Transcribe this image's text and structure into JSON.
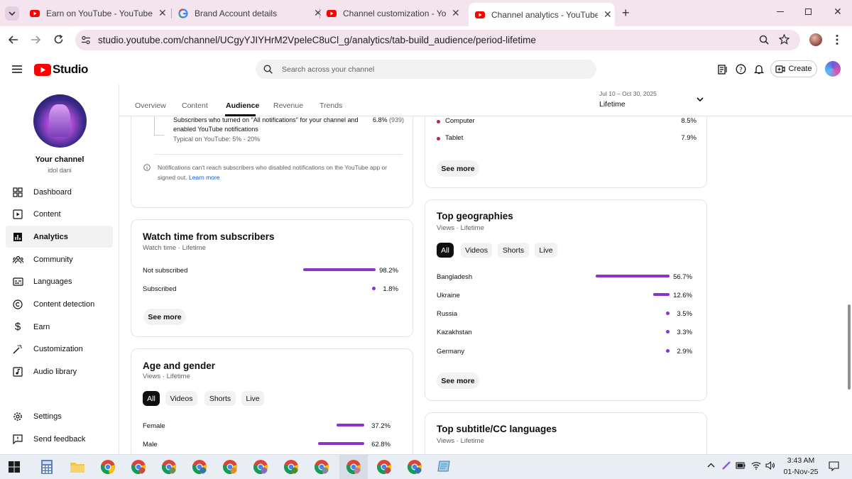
{
  "browser": {
    "tabs": [
      {
        "title": "Earn on YouTube - YouTube Stu",
        "active": false
      },
      {
        "title": "Brand Account details",
        "active": false
      },
      {
        "title": "Channel customization - YouTu",
        "active": false
      },
      {
        "title": "Channel analytics - YouTube Stu",
        "active": true
      }
    ],
    "url": "studio.youtube.com/channel/UCgyYJIYHrM2VpeleC8uCl_g/analytics/tab-build_audience/period-lifetime"
  },
  "studio": {
    "logo": "Studio",
    "search_placeholder": "Search across your channel",
    "create_label": "Create"
  },
  "sidebar": {
    "channel_title": "Your channel",
    "channel_name": "idol dani",
    "items": [
      {
        "label": "Dashboard",
        "icon": "dashboard-icon",
        "selected": false
      },
      {
        "label": "Content",
        "icon": "content-icon",
        "selected": false
      },
      {
        "label": "Analytics",
        "icon": "analytics-icon",
        "selected": true
      },
      {
        "label": "Community",
        "icon": "community-icon",
        "selected": false
      },
      {
        "label": "Languages",
        "icon": "languages-icon",
        "selected": false
      },
      {
        "label": "Content detection",
        "icon": "copyright-icon",
        "selected": false
      },
      {
        "label": "Earn",
        "icon": "dollar-icon",
        "selected": false
      },
      {
        "label": "Customization",
        "icon": "magic-wand-icon",
        "selected": false
      },
      {
        "label": "Audio library",
        "icon": "audio-library-icon",
        "selected": false
      }
    ],
    "bottom_items": [
      {
        "label": "Settings",
        "icon": "gear-icon"
      },
      {
        "label": "Send feedback",
        "icon": "feedback-icon"
      }
    ]
  },
  "main": {
    "tabs": [
      "Overview",
      "Content",
      "Audience",
      "Revenue",
      "Trends"
    ],
    "active_tab": "Audience",
    "period": {
      "range": "Jul 10 – Oct 30, 2025",
      "label": "Lifetime"
    },
    "notifications_card": {
      "row_text": "Subscribers who turned on \"All notifications\" for your channel and enabled YouTube notifications",
      "typical": "Typical on YouTube: 5% - 20%",
      "value": "6.8%",
      "count": "(939)",
      "info_text": "Notifications can't reach subscribers who disabled notifications on the YouTube app or signed out.",
      "learn_more": "Learn more"
    },
    "watch_time_card": {
      "title": "Watch time from subscribers",
      "subtitle": "Watch time · Lifetime",
      "rows": [
        {
          "label": "Not subscribed",
          "value": "98.2%",
          "fraction": 0.982
        },
        {
          "label": "Subscribed",
          "value": "1.8%",
          "fraction": 0.018
        }
      ],
      "see_more": "See more"
    },
    "age_gender_card": {
      "title": "Age and gender",
      "subtitle": "Views · Lifetime",
      "chips": [
        "All",
        "Videos",
        "Shorts",
        "Live"
      ],
      "rows": [
        {
          "label": "Female",
          "value": "37.2%",
          "fraction": 0.372
        },
        {
          "label": "Male",
          "value": "62.8%",
          "fraction": 0.628
        }
      ]
    },
    "device_card": {
      "rows": [
        {
          "label": "Computer",
          "value": "8.5%"
        },
        {
          "label": "Tablet",
          "value": "7.9%"
        }
      ],
      "see_more": "See more"
    },
    "geo_card": {
      "title": "Top geographies",
      "subtitle": "Views · Lifetime",
      "chips": [
        "All",
        "Videos",
        "Shorts",
        "Live"
      ],
      "rows": [
        {
          "label": "Bangladesh",
          "value": "56.7%",
          "fraction": 0.567
        },
        {
          "label": "Ukraine",
          "value": "12.6%",
          "fraction": 0.126
        },
        {
          "label": "Russia",
          "value": "3.5%",
          "fraction": 0.035
        },
        {
          "label": "Kazakhstan",
          "value": "3.3%",
          "fraction": 0.033
        },
        {
          "label": "Germany",
          "value": "2.9%",
          "fraction": 0.029
        }
      ],
      "see_more": "See more"
    },
    "subtitle_card": {
      "title": "Top subtitle/CC languages",
      "subtitle": "Views · Lifetime"
    }
  },
  "taskbar": {
    "time": "3:43 AM",
    "date": "01-Nov-25"
  },
  "colors": {
    "accent": "#8c33c9",
    "youtube_red": "#ff0000",
    "tabbar": "#f3e4ee"
  }
}
